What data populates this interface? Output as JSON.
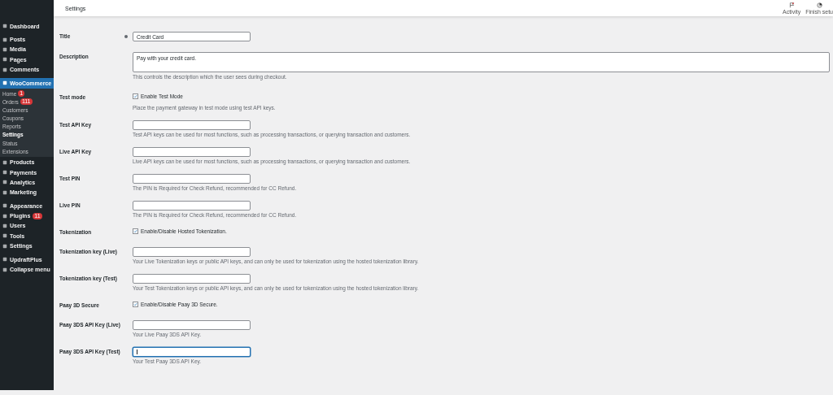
{
  "topbar": {
    "title": "Settings",
    "actions": [
      {
        "kind": "flag",
        "label": "Activity"
      },
      {
        "kind": "progress",
        "label": "Finish setu"
      }
    ]
  },
  "sidebar": {
    "groups": [
      [
        {
          "label": "Dashboard",
          "selected": false
        }
      ],
      [
        {
          "label": "Posts",
          "selected": false
        },
        {
          "label": "Media",
          "selected": false
        },
        {
          "label": "Pages",
          "selected": false
        },
        {
          "label": "Comments",
          "selected": false
        }
      ],
      [
        {
          "label": "WooCommerce",
          "selected": true,
          "children": [
            {
              "label": "Home",
              "badge": "1",
              "selected": false
            },
            {
              "label": "Orders",
              "badge": "111",
              "selected": false
            },
            {
              "label": "Customers",
              "selected": false
            },
            {
              "label": "Coupons",
              "selected": false
            },
            {
              "label": "Reports",
              "selected": false
            },
            {
              "label": "Settings",
              "selected": true
            },
            {
              "label": "Status",
              "selected": false
            },
            {
              "label": "Extensions",
              "selected": false
            }
          ]
        },
        {
          "label": "Products",
          "selected": false
        },
        {
          "label": "Payments",
          "selected": false
        },
        {
          "label": "Analytics",
          "selected": false
        },
        {
          "label": "Marketing",
          "selected": false
        }
      ],
      [
        {
          "label": "Appearance",
          "selected": false
        },
        {
          "label": "Plugins",
          "badge": "11",
          "selected": false
        },
        {
          "label": "Users",
          "selected": false
        },
        {
          "label": "Tools",
          "selected": false
        },
        {
          "label": "Settings",
          "selected": false
        }
      ],
      [
        {
          "label": "UpdraftPlus",
          "selected": false
        },
        {
          "label": "Collapse menu",
          "selected": false
        }
      ]
    ]
  },
  "form": [
    {
      "kind": "text",
      "label": "Title",
      "help": true,
      "value": "Credit Card",
      "focused": false
    },
    {
      "kind": "textarea",
      "label": "Description",
      "value": "Pay with your credit card.",
      "description": "This controls the description which the user sees during checkout."
    },
    {
      "kind": "checkbox",
      "label": "Test mode",
      "checked": true,
      "caption": "Enable Test Mode",
      "description": "Place the payment gateway in test mode using test API keys."
    },
    {
      "kind": "text",
      "label": "Test API Key",
      "focused": false,
      "description": "Test API keys can be used for most functions, such as processing transactions, or querying transaction and customers."
    },
    {
      "kind": "text",
      "label": "Live API Key",
      "focused": false,
      "description": "Live API keys can be used for most functions, such as processing transactions, or querying transaction and customers."
    },
    {
      "kind": "text",
      "label": "Test PIN",
      "focused": false,
      "description": "The PIN is Required for Check Refund, recommended for CC Refund."
    },
    {
      "kind": "text",
      "label": "Live PIN",
      "focused": false,
      "description": "The PIN is Required for Check Refund, recommended for CC Refund."
    },
    {
      "kind": "checkbox",
      "label": "Tokenization",
      "checked": true,
      "caption": "Enable/Disable Hosted Tokenization."
    },
    {
      "kind": "text",
      "label": "Tokenization key (Live)",
      "focused": false,
      "description": "Your Live Tokenization keys or public API keys, and can only be used for tokenization using the hosted tokenization library."
    },
    {
      "kind": "text",
      "label": "Tokenization key (Test)",
      "focused": false,
      "description": "Your Test Tokenization keys or public API keys, and can only be used for tokenization using the hosted tokenization library."
    },
    {
      "kind": "checkbox",
      "label": "Paay 3D Secure",
      "checked": true,
      "caption": "Enable/Disable Paay 3D Secure."
    },
    {
      "kind": "text",
      "label": "Paay 3DS API Key (Live)",
      "focused": false,
      "description": "Your Live Paay 3DS API Key."
    },
    {
      "kind": "text",
      "label": "Paay 3DS API Key (Test)",
      "focused": true,
      "description": "Your Test Paay 3DS API Key."
    }
  ]
}
